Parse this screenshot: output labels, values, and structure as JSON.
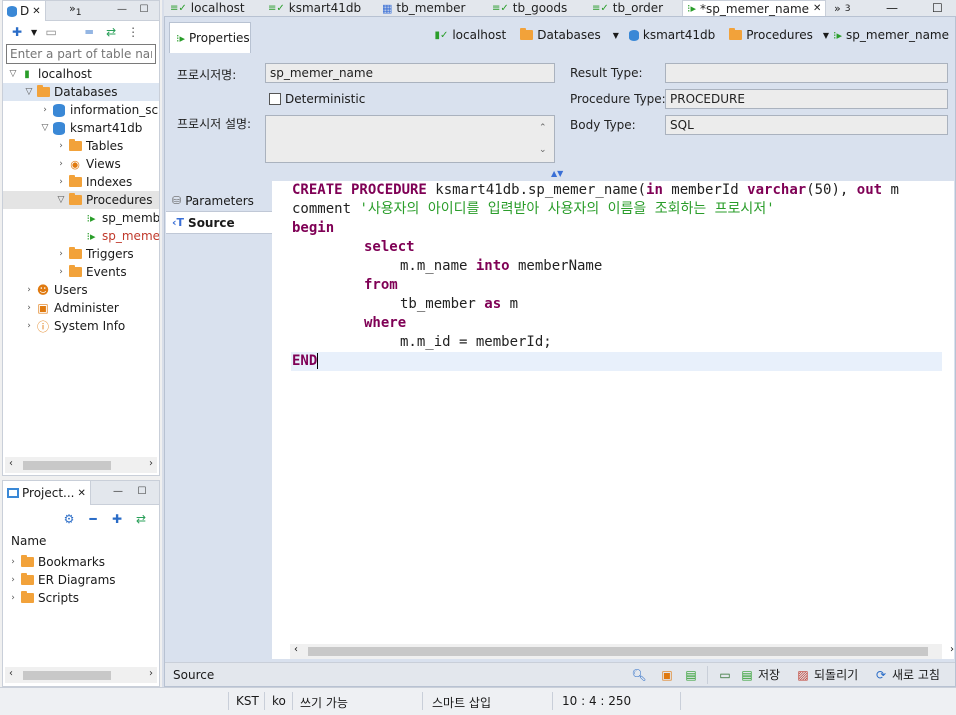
{
  "db_nav": {
    "tab_label": "D",
    "tab_overflow": "1",
    "filter_placeholder": "Enter a part of table name",
    "tree": {
      "connection": "localhost",
      "databases": "Databases",
      "information_schema": "information_sc",
      "ksmart41db": "ksmart41db",
      "tables": "Tables",
      "views": "Views",
      "indexes": "Indexes",
      "procedures": "Procedures",
      "proc1": "sp_memb",
      "proc2": "sp_meme",
      "triggers": "Triggers",
      "events": "Events",
      "users": "Users",
      "administer": "Administer",
      "system_info": "System Info"
    }
  },
  "projects": {
    "tab_label": "Project...",
    "header": "Name",
    "items": [
      "Bookmarks",
      "ER Diagrams",
      "Scripts"
    ]
  },
  "editor_tabs": {
    "tabs": [
      "localhost",
      "ksmart41db",
      "tb_member",
      "tb_goods",
      "tb_order",
      "*sp_memer_name"
    ],
    "overflow": "3"
  },
  "editor": {
    "properties_tab": "Properties",
    "breadcrumbs": [
      "localhost",
      "Databases",
      "ksmart41db",
      "Procedures",
      "sp_memer_name"
    ],
    "form": {
      "name_label": "프로시저명:",
      "name_value": "sp_memer_name",
      "deterministic_label": "Deterministic",
      "desc_label": "프로시저 설명:",
      "desc_value": "",
      "result_type_label": "Result Type:",
      "result_type_value": "",
      "procedure_type_label": "Procedure Type:",
      "procedure_type_value": "PROCEDURE",
      "body_type_label": "Body Type:",
      "body_type_value": "SQL"
    },
    "side_tabs": [
      "Parameters",
      "Source"
    ],
    "code": {
      "line1": {
        "kw1": "CREATE PROCEDURE",
        "t1": " ksmart41db.sp_memer_name(",
        "kw2": "in",
        "t2": " memberId ",
        "kw3": "varchar",
        "t3": "(50), ",
        "kw4": "out",
        "t4": " m"
      },
      "line2": {
        "t1": "comment ",
        "str": "'사용자의 아이디를 입력받아 사용자의 이름을 조회하는 프로시저'"
      },
      "line3": {
        "kw": "begin"
      },
      "line4": {
        "kw": "select"
      },
      "line5": {
        "t1": "m.m_name ",
        "kw": "into",
        "t2": " memberName"
      },
      "line6": {
        "kw": "from"
      },
      "line7": {
        "t1": "tb_member ",
        "kw": "as",
        "t2": " m"
      },
      "line8": {
        "kw": "where"
      },
      "line9": {
        "t1": "m.m_id = memberId;"
      },
      "line10": {
        "kw": "END"
      }
    },
    "footer": {
      "label": "Source",
      "save": "저장",
      "revert": "되돌리기",
      "refresh": "새로 고침"
    }
  },
  "status": {
    "tz": "KST",
    "lang": "ko",
    "write_mode": "쓰기 가능",
    "insert_mode": "스마트 삽입",
    "position": "10 : 4 : 250"
  },
  "colors": {
    "keyword": "#7f0055",
    "string": "#2a9d2a",
    "folder": "#f2a23a",
    "db": "#3a88d6",
    "selection": "#dde6f2"
  }
}
